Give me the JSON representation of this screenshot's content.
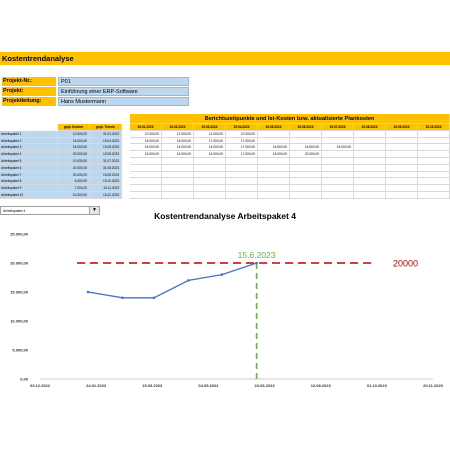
{
  "sheet": {
    "title": "Kostentrendanalyse",
    "info": [
      {
        "label": "Projekt-Nr.:",
        "value": "P01"
      },
      {
        "label": "Projekt:",
        "value": "Einführung einer ERP-Software"
      },
      {
        "label": "Projektleitung:",
        "value": "Hans Mustermann"
      }
    ],
    "header_main": "Berichtszeitpunkte und Ist-Kosten bzw. aktualisierte Plankosten",
    "col_kosten": "gepl. Kosten",
    "col_termin": "gepl. Termin",
    "dates": [
      "15.01.2023",
      "15.02.2023",
      "15.03.2023",
      "15.04.2023",
      "15.05.2023",
      "15.06.2023",
      "15.07.2023",
      "15.08.2023",
      "15.09.2023",
      "15.10.2023"
    ],
    "rows": [
      {
        "label": "Arbeitspaket 1",
        "kosten": "10.000,00",
        "termin": "31.01.2023",
        "values": [
          "10.000,00",
          "12.000,00",
          "11.000,00",
          "10.000,00",
          "",
          "",
          "",
          "",
          "",
          ""
        ]
      },
      {
        "label": "Arbeitspaket 2",
        "kosten": "15.000,00",
        "termin": "15.04.2023",
        "values": [
          "15.000,00",
          "16.000,00",
          "17.000,00",
          "17.000,00",
          "",
          "",
          "",
          "",
          "",
          ""
        ]
      },
      {
        "label": "Arbeitspaket 3",
        "kosten": "15.000,00",
        "termin": "15.05.2023",
        "values": [
          "15.000,00",
          "14.000,00",
          "14.000,00",
          "17.000,00",
          "16.500,00",
          "16.500,00",
          "15.000,00",
          "",
          "",
          ""
        ]
      },
      {
        "label": "Arbeitspaket 4",
        "kosten": "20.000,00",
        "termin": "15.06.2023",
        "values": [
          "15.000,00",
          "14.000,00",
          "14.000,00",
          "17.000,00",
          "18.000,00",
          "20.000,00",
          "",
          "",
          "",
          ""
        ]
      },
      {
        "label": "Arbeitspaket 5",
        "kosten": "10.000,00",
        "termin": "31.07.2023",
        "values": [
          "",
          "",
          "",
          "",
          "",
          "",
          "",
          "",
          "",
          ""
        ]
      },
      {
        "label": "Arbeitspaket 6",
        "kosten": "20.000,00",
        "termin": "31.08.2023",
        "values": [
          "",
          "",
          "",
          "",
          "",
          "",
          "",
          "",
          "",
          ""
        ]
      },
      {
        "label": "Arbeitspaket 7",
        "kosten": "20.000,00",
        "termin": "15.09.2023",
        "values": [
          "",
          "",
          "",
          "",
          "",
          "",
          "",
          "",
          "",
          ""
        ]
      },
      {
        "label": "Arbeitspaket 8",
        "kosten": "5.000,00",
        "termin": "15.10.2023",
        "values": [
          "",
          "",
          "",
          "",
          "",
          "",
          "",
          "",
          "",
          ""
        ]
      },
      {
        "label": "Arbeitspaket 9",
        "kosten": "7.000,00",
        "termin": "15.11.2023",
        "values": [
          "",
          "",
          "",
          "",
          "",
          "",
          "",
          "",
          "",
          ""
        ]
      },
      {
        "label": "Arbeitspaket 10",
        "kosten": "10.000,00",
        "termin": "15.12.2023",
        "values": [
          "",
          "",
          "",
          "",
          "",
          "",
          "",
          "",
          "",
          ""
        ]
      }
    ],
    "dropdown_value": "Arbeitspaket 4"
  },
  "chart_data": {
    "type": "line",
    "title": "Kostentrendanalyse Arbeitspaket 4",
    "x_ticks": [
      "03.12.2022",
      "24.01.2023",
      "15.03.2023",
      "04.05.2023",
      "23.06.2023",
      "12.08.2023",
      "01.10.2023",
      "20.11.2023"
    ],
    "y_ticks": [
      "0,00",
      "5.000,00",
      "10.000,00",
      "15.000,00",
      "20.000,00",
      "25.000,00"
    ],
    "ylim": [
      0,
      25000
    ],
    "xlim": [
      "2022-12-03",
      "2023-11-20"
    ],
    "series": [
      {
        "x": [
          "2023-01-15",
          "2023-02-15",
          "2023-03-15",
          "2023-04-15",
          "2023-05-15",
          "2023-06-15"
        ],
        "y": [
          15000,
          14000,
          14000,
          17000,
          18000,
          20000
        ],
        "color": "#4472c4"
      }
    ],
    "planned_cost": {
      "value": 20000,
      "label": "20000",
      "color": "#c00000"
    },
    "planned_date": {
      "value": "2023-06-15",
      "label": "15.6.2023",
      "color": "#70ad47"
    }
  }
}
